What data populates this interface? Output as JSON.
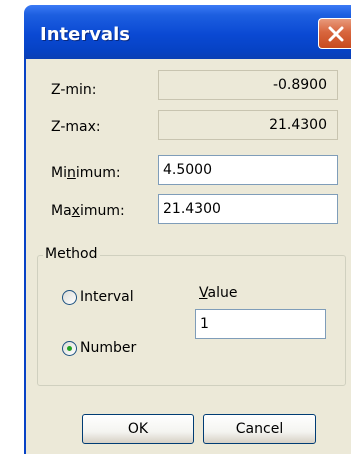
{
  "window": {
    "title": "Intervals"
  },
  "fields": {
    "zmin_label": "Z-min:",
    "zmin_value": "-0.8900",
    "zmax_label": "Z-max:",
    "zmax_value": "21.4300",
    "minimum_label_pre": "Mi",
    "minimum_label_key": "n",
    "minimum_label_post": "imum:",
    "minimum_value": "4.5000",
    "maximum_label_pre": "Ma",
    "maximum_label_key": "x",
    "maximum_label_post": "imum:",
    "maximum_value": "21.4300"
  },
  "method": {
    "group_label": "Method",
    "options": [
      {
        "label": "Interval",
        "selected": false
      },
      {
        "label": "Number",
        "selected": true
      }
    ],
    "value_label_key": "V",
    "value_label_rest": "alue",
    "value": "1"
  },
  "buttons": {
    "ok": "OK",
    "cancel": "Cancel"
  },
  "colors": {
    "titlebar": "#0a49d3",
    "dialog_bg": "#ece9d8",
    "close": "#d8663e",
    "radio_dot": "#21a121"
  }
}
